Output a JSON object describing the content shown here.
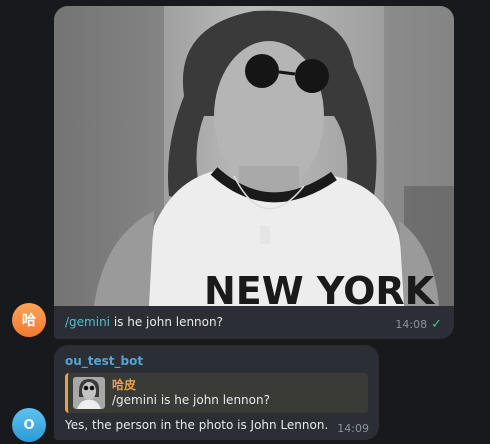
{
  "messages": [
    {
      "avatar_initial": "哈",
      "command": "/gemini",
      "text": " is he john lennon?",
      "time": "14:08",
      "status_icon": "check-icon"
    },
    {
      "avatar_initial": "O",
      "sender": "ou_test_bot",
      "reply_to": {
        "name": "哈皮",
        "text": "/gemini is he john lennon?"
      },
      "text": "Yes, the person in the photo is John Lennon.",
      "time": "14:09"
    }
  ],
  "colors": {
    "background": "#17191d",
    "bubble": "#2b2f35",
    "command": "#52bfd4",
    "sender": "#4fa6d8",
    "reply_accent": "#e6a24a",
    "read_check": "#4fbf8c"
  }
}
